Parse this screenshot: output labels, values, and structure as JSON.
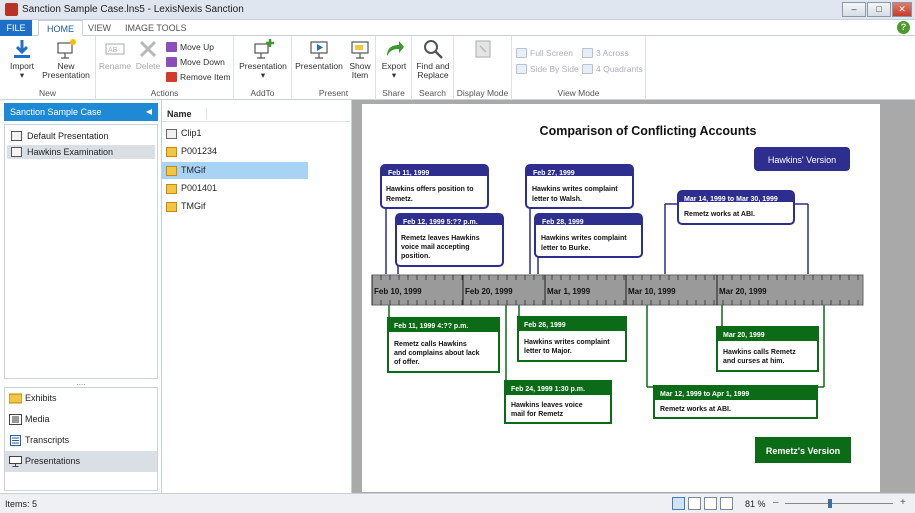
{
  "window": {
    "title": "Sanction Sample Case.lns5 - LexisNexis Sanction",
    "controls": [
      "minimize",
      "maximize",
      "close"
    ]
  },
  "tabs": [
    {
      "label": "FILE",
      "active": false
    },
    {
      "label": "HOME",
      "active": true
    },
    {
      "label": "VIEW",
      "active": false
    },
    {
      "label": "IMAGE TOOLS",
      "active": false
    }
  ],
  "ribbon": {
    "new": {
      "label": "New",
      "import": "Import",
      "new_presentation": "New Presentation"
    },
    "actions": {
      "label": "Actions",
      "rename": "Rename",
      "delete": "Delete",
      "move_up": "Move Up",
      "move_down": "Move Down",
      "remove_item": "Remove Item"
    },
    "addto": {
      "label": "AddTo",
      "presentation": "Presentation"
    },
    "present": {
      "label": "Present",
      "presentation": "Presentation",
      "show_item": "Show Item"
    },
    "share": {
      "label": "Share",
      "export": "Export"
    },
    "search": {
      "label": "Search",
      "find_replace": "Find and Replace"
    },
    "display_mode": {
      "label": "Display Mode"
    },
    "view_mode": {
      "label": "View Mode",
      "full_screen": "Full Screen",
      "three_across": "3 Across",
      "side_by_side": "Side By Side",
      "four_quadrants": "4 Quadrants"
    }
  },
  "left_panel": {
    "case_title": "Sanction Sample Case",
    "presentations": [
      {
        "label": "Default Presentation",
        "selected": false
      },
      {
        "label": "Hawkins Examination",
        "selected": true
      }
    ],
    "nav": [
      {
        "label": "Exhibits",
        "icon": "exhibits-icon",
        "selected": false
      },
      {
        "label": "Media",
        "icon": "media-icon",
        "selected": false
      },
      {
        "label": "Transcripts",
        "icon": "transcripts-icon",
        "selected": false
      },
      {
        "label": "Presentations",
        "icon": "presentations-icon",
        "selected": true
      }
    ]
  },
  "middle_panel": {
    "column_header": "Name",
    "items": [
      {
        "label": "Clip1",
        "type": "clip",
        "selected": false
      },
      {
        "label": "P001234",
        "type": "image",
        "selected": false
      },
      {
        "label": "TMGif",
        "type": "image",
        "selected": true
      },
      {
        "label": "P001401",
        "type": "image",
        "selected": false
      },
      {
        "label": "TMGif",
        "type": "image",
        "selected": false
      }
    ]
  },
  "slide": {
    "title": "Comparison of Conflicting Accounts",
    "hawkins_label": "Hawkins' Version",
    "remetz_label": "Remetz's Version",
    "colors": {
      "hawkins": "#2e2e8f",
      "remetz": "#0b6b16",
      "axis": "#9a9a9a"
    },
    "axis_labels": [
      "Feb 10, 1999",
      "Feb 20, 1999",
      "Mar 1, 1999",
      "Mar 10, 1999",
      "Mar 20, 1999"
    ],
    "hawkins_events": [
      {
        "date": "Feb 11, 1999",
        "text": "Hawkins offers position to Remetz."
      },
      {
        "date": "Feb 12, 1999 5:?? p.m.",
        "text": "Remetz leaves Hawkins voice mail accepting position."
      },
      {
        "date": "Feb 27, 1999",
        "text": "Hawkins writes complaint letter to Walsh."
      },
      {
        "date": "Feb 28, 1999",
        "text": "Hawkins writes complaint letter to Burke."
      },
      {
        "date": "Mar 14, 1999 to Mar 30, 1999",
        "text": "Remetz works at ABI."
      }
    ],
    "remetz_events": [
      {
        "date": "Feb 11, 1999 4:?? p.m.",
        "text": "Remetz calls Hawkins and complains about lack of offer."
      },
      {
        "date": "Feb 26, 1999",
        "text": "Hawkins writes complaint letter to Major."
      },
      {
        "date": "Feb 24, 1999 1:30 p.m.",
        "text": "Hawkins leaves voice mail for Remetz"
      },
      {
        "date": "Mar 20, 1999",
        "text": "Hawkins calls Remetz and curses at him."
      },
      {
        "date": "Mar 12, 1999 to Apr 1, 1999",
        "text": "Remetz works at ABI."
      }
    ]
  },
  "status": {
    "items": "Items: 5",
    "zoom": "81 %",
    "zoom_level_percent": 40
  }
}
